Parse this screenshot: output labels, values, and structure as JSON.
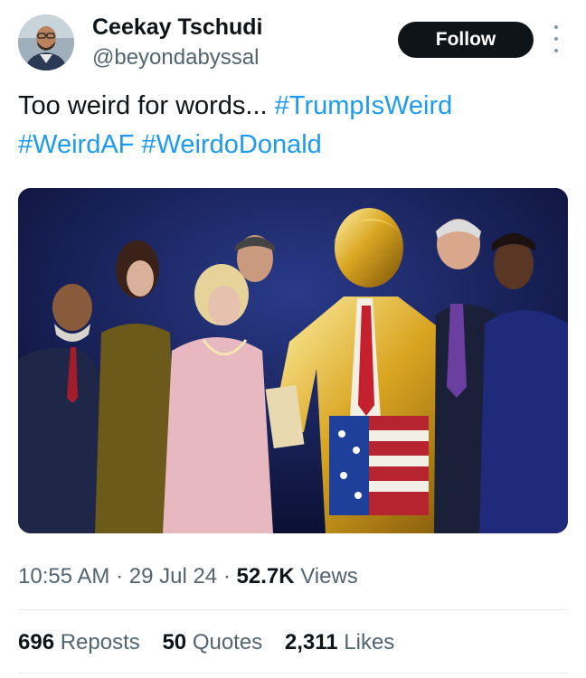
{
  "author": {
    "name": "Ceekay Tschudi",
    "handle": "@beyondabyssal",
    "avatar_icon": "person-photo-avatar"
  },
  "actions": {
    "follow_label": "Follow",
    "more_icon": "vertical-ellipsis-icon"
  },
  "tweet": {
    "text": "Too weird for words...",
    "hashtags": [
      "#TrumpIsWeird",
      "#WeirdAF",
      "#WeirdoDonald"
    ],
    "media_description_icon": "photo-golden-statue"
  },
  "meta": {
    "time": "10:55 AM",
    "separator": "·",
    "date": "29 Jul 24",
    "views_count": "52.7K",
    "views_label": "Views"
  },
  "stats": {
    "reposts_count": "696",
    "reposts_label": "Reposts",
    "quotes_count": "50",
    "quotes_label": "Quotes",
    "likes_count": "2,311",
    "likes_label": "Likes"
  },
  "colors": {
    "link": "#1d9bf0",
    "secondary_text": "#536471",
    "primary_text": "#0f1419",
    "follow_bg": "#0f1419"
  }
}
